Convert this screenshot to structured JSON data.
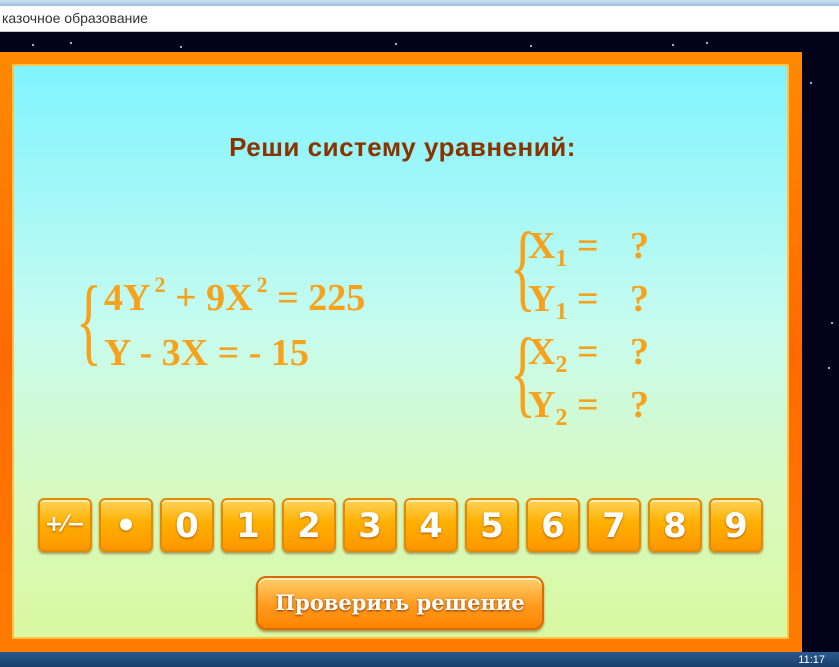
{
  "window": {
    "title": "казочное образование"
  },
  "task": {
    "heading": "Реши систему уравнений:"
  },
  "system": {
    "line1": {
      "a": "4Y",
      "exp1": "2",
      "b": " + 9X",
      "exp2": "2",
      "c": " = 225"
    },
    "line2": "Y - 3X = - 15"
  },
  "answers": [
    {
      "var": "X",
      "sub": "1",
      "eq": " =",
      "val": "?"
    },
    {
      "var": "Y",
      "sub": "1",
      "eq": " =",
      "val": "?"
    },
    {
      "var": "X",
      "sub": "2",
      "eq": " =",
      "val": "?"
    },
    {
      "var": "Y",
      "sub": "2",
      "eq": " =",
      "val": "?"
    }
  ],
  "keypad": {
    "plus_minus": "+⁄−",
    "dot": "•",
    "digits": [
      "0",
      "1",
      "2",
      "3",
      "4",
      "5",
      "6",
      "7",
      "8",
      "9"
    ]
  },
  "check_button": "Проверить решение",
  "taskbar": {
    "clock": "11:17"
  },
  "colors": {
    "frame": "#ff7c00",
    "equation": "#f6a21c",
    "heading": "#8b3300"
  }
}
